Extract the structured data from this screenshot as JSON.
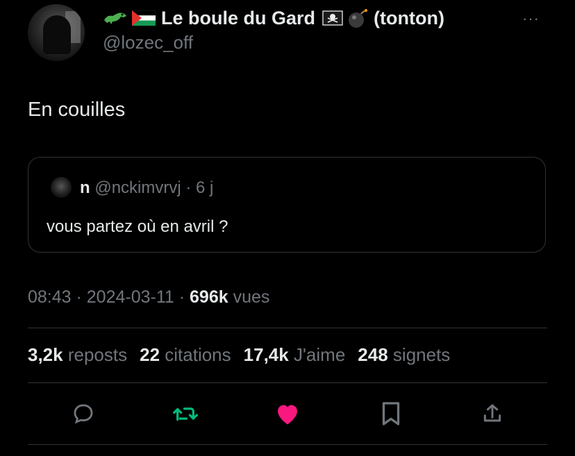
{
  "author": {
    "display_name": "Le boule du Gard",
    "name_suffix": "(tonton)",
    "handle": "@lozec_off",
    "emoji_icons": [
      "crocodile-icon",
      "palestine-flag-icon",
      "pirate-flag-icon",
      "bomb-icon"
    ]
  },
  "more_label": "···",
  "tweet": {
    "text": "En couilles"
  },
  "quoted": {
    "name": "n",
    "meta": "@nckimvrvj · 6 j",
    "text": "vous partez où en avril ?"
  },
  "meta": {
    "time_date": "08:43 · 2024-03-11 · ",
    "views_count": "696k",
    "views_label": " vues"
  },
  "stats": [
    {
      "count": "3,2k",
      "label": "reposts"
    },
    {
      "count": "22",
      "label": "citations"
    },
    {
      "count": "17,4k",
      "label": "J'aime"
    },
    {
      "count": "248",
      "label": "signets"
    }
  ],
  "actions": [
    {
      "name": "reply-icon",
      "color": "#71767b"
    },
    {
      "name": "repost-icon",
      "color": "#00ba7c"
    },
    {
      "name": "like-icon",
      "color": "#f91880"
    },
    {
      "name": "bookmark-icon",
      "color": "#71767b"
    },
    {
      "name": "share-icon",
      "color": "#71767b"
    }
  ],
  "colors": {
    "background": "#000000",
    "text": "#e7e9ea",
    "muted": "#71767b",
    "border": "#2f3336"
  }
}
